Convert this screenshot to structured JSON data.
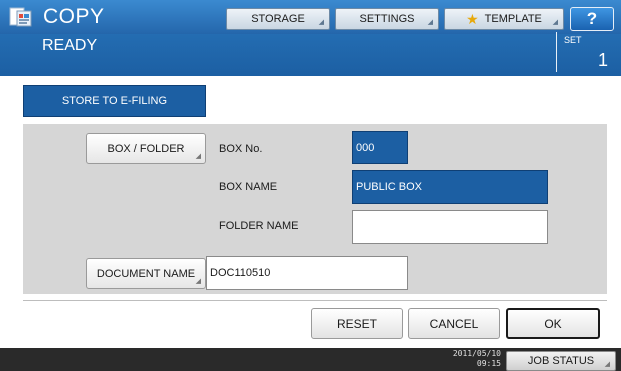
{
  "header": {
    "title": "COPY",
    "status": "READY",
    "set_label": "SET",
    "set_value": "1",
    "buttons": {
      "storage": "STORAGE",
      "settings": "SETTINGS",
      "template": "TEMPLATE",
      "help": "?"
    },
    "icons": {
      "app": "copy-app-icon",
      "template": "star-icon",
      "arrow": "corner-arrow-icon"
    }
  },
  "function_tab": "STORE TO E-FILING",
  "form": {
    "box_folder_button": "BOX / FOLDER",
    "box_no_label": "BOX No.",
    "box_no_value": "000",
    "box_name_label": "BOX NAME",
    "box_name_value": "PUBLIC BOX",
    "folder_name_label": "FOLDER NAME",
    "folder_name_value": "",
    "document_name_button": "DOCUMENT NAME",
    "document_name_value": "DOC110510"
  },
  "actions": {
    "reset": "RESET",
    "cancel": "CANCEL",
    "ok": "OK"
  },
  "status_bar": {
    "date": "2011/05/10",
    "time": "09:15",
    "job_status": "JOB STATUS"
  },
  "colors": {
    "header_blue": "#1c5fa3",
    "panel_grey": "#d6d6d6",
    "status_bar": "#2a2a2a",
    "selected_field": "#1c5fa3"
  }
}
